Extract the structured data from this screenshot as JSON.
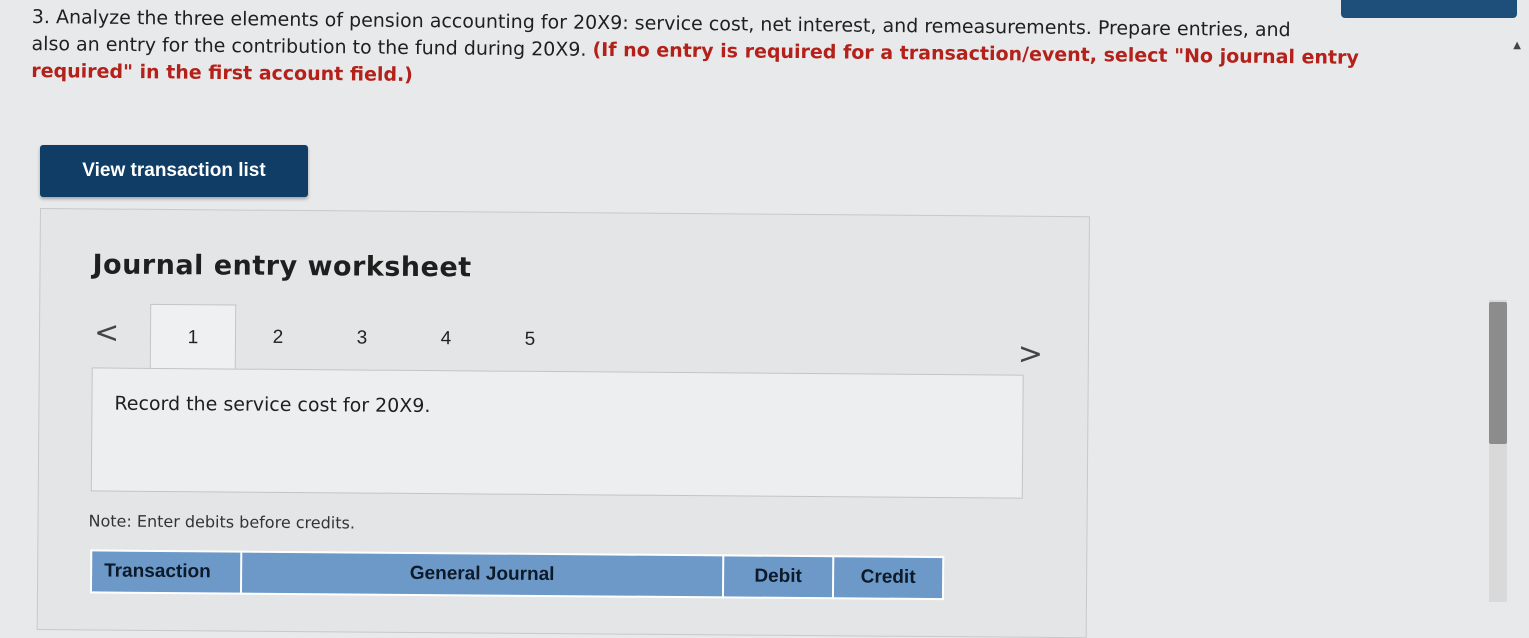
{
  "question": {
    "line1": "3. Analyze the three elements of pension accounting for 20X9: service cost, net interest, and remeasurements. Prepare entries, and",
    "line2_plain": "also an entry for the contribution to the fund during 20X9. ",
    "line2_red": "(If no entry is required for a transaction/event, select \"No journal entry",
    "line3_red": "required\" in the first account field.)"
  },
  "view_button": {
    "label": "View transaction list"
  },
  "worksheet": {
    "title": "Journal entry worksheet",
    "prev_glyph": "<",
    "next_glyph": ">",
    "tabs": [
      {
        "label": "1",
        "active": true
      },
      {
        "label": "2",
        "active": false
      },
      {
        "label": "3",
        "active": false
      },
      {
        "label": "4",
        "active": false
      },
      {
        "label": "5",
        "active": false
      }
    ],
    "record_text": "Record the service cost for 20X9.",
    "note": "Note: Enter debits before credits."
  },
  "journal_table": {
    "headers": [
      "Transaction",
      "General Journal",
      "Debit",
      "Credit"
    ]
  },
  "colors": {
    "primary_button": "#0f3d66",
    "table_header": "#6d99c8",
    "instruction_red": "#b3211a"
  }
}
